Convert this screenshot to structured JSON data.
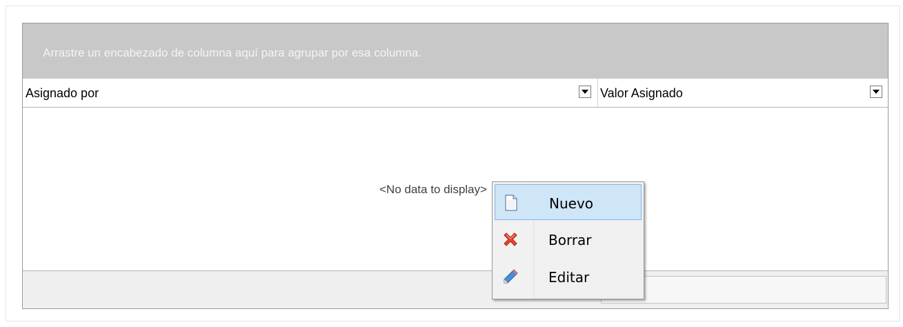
{
  "grid": {
    "group_panel_text": "Arrastre un encabezado de columna aquí para agrupar por esa columna.",
    "columns": [
      {
        "label": "Asignado por"
      },
      {
        "label": "Valor Asignado"
      }
    ],
    "empty_text": "<No data to display>"
  },
  "context_menu": {
    "items": [
      {
        "label": "Nuevo",
        "icon": "new-document-icon",
        "highlighted": true
      },
      {
        "label": "Borrar",
        "icon": "delete-x-icon",
        "highlighted": false
      },
      {
        "label": "Editar",
        "icon": "pencil-icon",
        "highlighted": false
      }
    ]
  },
  "colors": {
    "group_panel": "#c8c8c8",
    "menu_highlight": "#cfe5f8",
    "menu_highlight_border": "#82b6e4"
  }
}
